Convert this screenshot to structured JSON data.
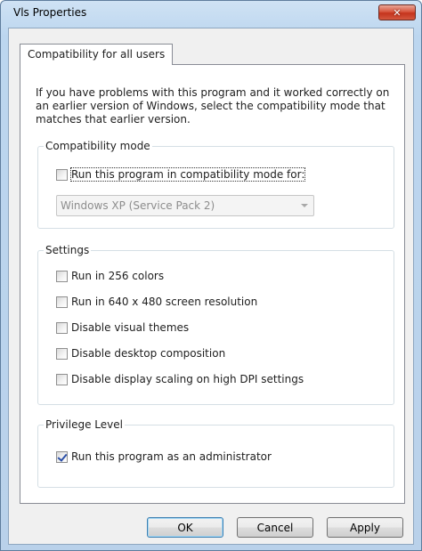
{
  "window": {
    "title": "Vls Properties",
    "close_glyph": "✕"
  },
  "tabs": [
    {
      "label": "Compatibility for all users"
    }
  ],
  "intro_text": "If you have problems with this program and it worked correctly on an earlier version of Windows, select the compatibility mode that matches that earlier version.",
  "compatibility_mode": {
    "group_label": "Compatibility mode",
    "checkbox_label": "Run this program in compatibility mode for:",
    "checked": false,
    "selected_os": "Windows XP (Service Pack 2)"
  },
  "settings": {
    "group_label": "Settings",
    "options": [
      {
        "label": "Run in 256 colors",
        "checked": false
      },
      {
        "label": "Run in 640 x 480 screen resolution",
        "checked": false
      },
      {
        "label": "Disable visual themes",
        "checked": false
      },
      {
        "label": "Disable desktop composition",
        "checked": false
      },
      {
        "label": "Disable display scaling on high DPI settings",
        "checked": false
      }
    ]
  },
  "privilege_level": {
    "group_label": "Privilege Level",
    "checkbox_label": "Run this program as an administrator",
    "checked": true
  },
  "buttons": {
    "ok": "OK",
    "cancel": "Cancel",
    "apply": "Apply"
  },
  "colors": {
    "titlebar": "#bcd6ef",
    "close_button": "#c4341d",
    "dialog_face": "#f0f0f0",
    "check_mark": "#2b4fa7"
  }
}
